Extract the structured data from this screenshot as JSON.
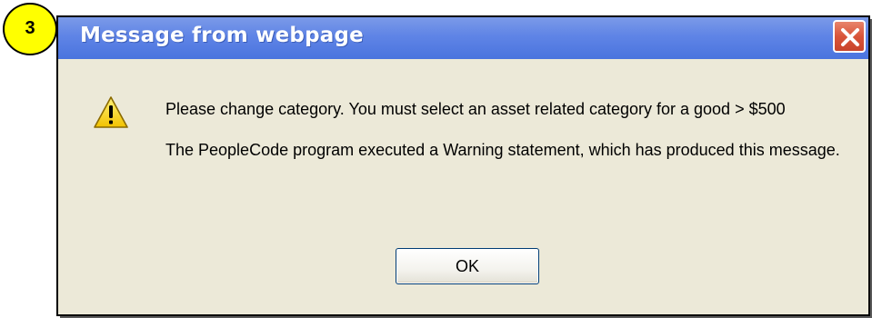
{
  "step_badge": {
    "number": "3",
    "color": "#ffff00"
  },
  "dialog": {
    "title": "Message from webpage",
    "close_icon": "close-icon",
    "warning_icon": "warning-icon",
    "messages": [
      "Please change category. You must select an asset related category for a good > $500",
      "The PeopleCode program executed a Warning statement, which has produced this message."
    ],
    "ok_label": "OK"
  },
  "colors": {
    "titlebar": "#5f84e6",
    "close_button": "#d9553a",
    "dialog_background": "#ece9d8"
  }
}
